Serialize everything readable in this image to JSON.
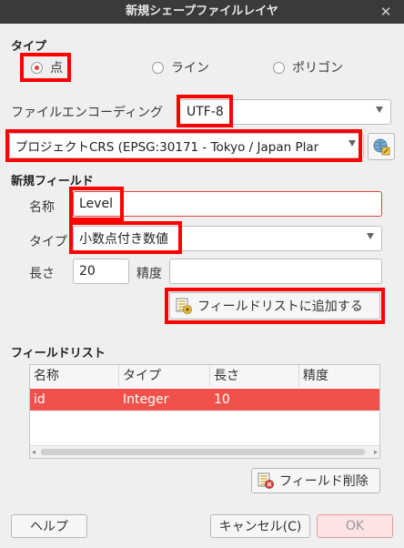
{
  "window": {
    "title": "新規シェープファイルレイヤ"
  },
  "type_section": {
    "title": "タイプ",
    "options": [
      "点",
      "ライン",
      "ポリゴン"
    ],
    "selected": "点"
  },
  "encoding": {
    "label": "ファイルエンコーディング",
    "value": "UTF-8"
  },
  "crs": {
    "value": "プロジェクトCRS (EPSG:30171 - Tokyo / Japan Plar"
  },
  "new_field": {
    "title": "新規フィールド",
    "name_label": "名称",
    "name_value": "Level",
    "type_label": "タイプ",
    "type_value": "小数点付き数値",
    "length_label": "長さ",
    "length_value": "20",
    "precision_label": "精度",
    "precision_value": "",
    "add_button": "フィールドリストに追加する"
  },
  "field_list": {
    "title": "フィールドリスト",
    "headers": [
      "名称",
      "タイプ",
      "長さ",
      "精度"
    ],
    "rows": [
      {
        "name": "id",
        "type": "Integer",
        "length": "10",
        "precision": ""
      }
    ],
    "delete_button": "フィールド削除"
  },
  "footer": {
    "help": "ヘルプ",
    "cancel": "キャンセル(C)",
    "ok": "OK"
  },
  "colors": {
    "accent": "#e0443e",
    "selection": "#f0524b",
    "annotation": "#ff0000"
  }
}
